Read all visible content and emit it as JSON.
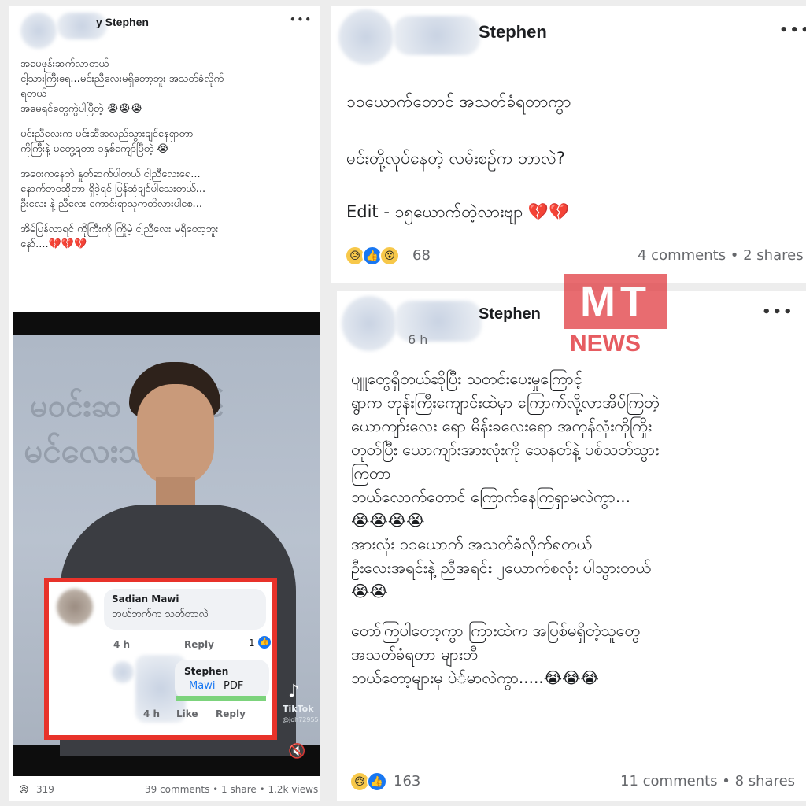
{
  "left_post": {
    "author": "y Stephen",
    "more": "•••",
    "lines": [
      "အမေဖုန်းဆက်လာတယ်",
      "ငါ့သားကြီးရေ...မင်းညီလေးမရှိတော့ဘူး အသတ်ခံလိုက်",
      "ရတယ်",
      "အမေရင်တွေကွဲပါပြီတဲ့ 😭😭😭",
      "",
      "မင်းညီလေးက မင်းဆီအလည်သွားချင်နေရှာတာ",
      "ကိုကြီးနဲ့ မတွေ့ရတာ ၁နှစ်ကျော်ပြီတဲ့ 😭",
      "",
      "အဝေးကနေဘဲ နှုတ်ဆက်ပါတယ် ငါ့ညီလေးရေ...",
      "နောက်ဘဝဆိုတာ ရှိခဲ့ရင် ပြန်ဆုံချင်ပါသေးတယ်...",
      "ဦးလေး နဲ့ ညီလေး ကောင်းရာသုကတိလားပါစေ...",
      "",
      "အိမ်ပြန်လာရင် ကိုကြီးကို ကြိုမဲ့ ငါ့ညီလေး မရှိတော့ဘူး",
      "နော်....💔💔💔"
    ],
    "photo_bg_text_1": "မဝင်းဆ ᱦောင်",
    "photo_bg_text_2": "မင်လေးသန့်ခံပွဲ",
    "tiktok_label": "TikTok",
    "tiktok_user": "@joh72955",
    "comment_1": {
      "author": "Sadian Mawi",
      "text": "ဘယ်ဘက်က သတ်တာလဲ",
      "time": "4 h",
      "reply": "Reply",
      "likes": "1"
    },
    "comment_2": {
      "author": "Stephen",
      "mention": "Mawi",
      "text": "PDF",
      "time": "4 h",
      "like": "Like",
      "reply": "Reply"
    },
    "reaction_count": "319",
    "stats": "39 comments • 1 share • 1.2k views"
  },
  "top_right_post": {
    "author": "Stephen",
    "more": "•••",
    "line_1": "၁၁ယောက်တောင် အသတ်ခံရတာကွာ",
    "line_2": "မင်းတို့လုပ်နေတဲ့ လမ်းစဉ်က ဘာလဲ?",
    "line_3": "Edit - ၁၅ယောက်တဲ့လားဗျာ 💔💔",
    "reaction_count": "68",
    "stats": "4 comments • 2 shares"
  },
  "watermark": {
    "logo": "MT",
    "text": "NEWS"
  },
  "bottom_right_post": {
    "author": "Stephen",
    "time": "6 h",
    "more": "•••",
    "lines": [
      "ပျူတွေရှိတယ်ဆိုပြီး သတင်းပေးမှုကြောင့်",
      "ရွာက ဘုန်းကြီးကျောင်းထဲမှာ ကြောက်လို့လာအိပ်ကြတဲ့",
      "ယောကျာ်းလေး ရော မိန်းခလေးရော အကုန်လုံးကိုကြိုး",
      "တုတ်ပြီး ယောကျာ်းအားလုံးကို သေနတ်နဲ့ ပစ်သတ်သွား",
      "ကြတာ",
      "ဘယ်လောက်တောင် ကြောက်နေကြရှာမလဲကွာ...",
      "😭😭😭😭",
      "အားလုံး ၁၁ယောက် အသတ်ခံလိုက်ရတယ်",
      "ဦးလေးအရင်းနဲ့ ညီအရင်း ၂ယောက်စလုံး ပါသွားတယ်",
      "😭😭",
      "",
      "တော်ကြပါတော့ကွာ ကြားထဲက အပြစ်မရှိတဲ့သူတွေ",
      "အသတ်ခံရတာ များဘီ",
      "ဘယ်တော့များမှ ပဲ်မှာလဲကွာ.....😭😭😭"
    ],
    "reaction_count": "163",
    "stats": "11 comments • 8 shares"
  },
  "colors": {
    "highlight_box": "#e8322a",
    "watermark": "#e0343a",
    "link_blue": "#1877f2",
    "green_bar": "#7cd37c"
  }
}
